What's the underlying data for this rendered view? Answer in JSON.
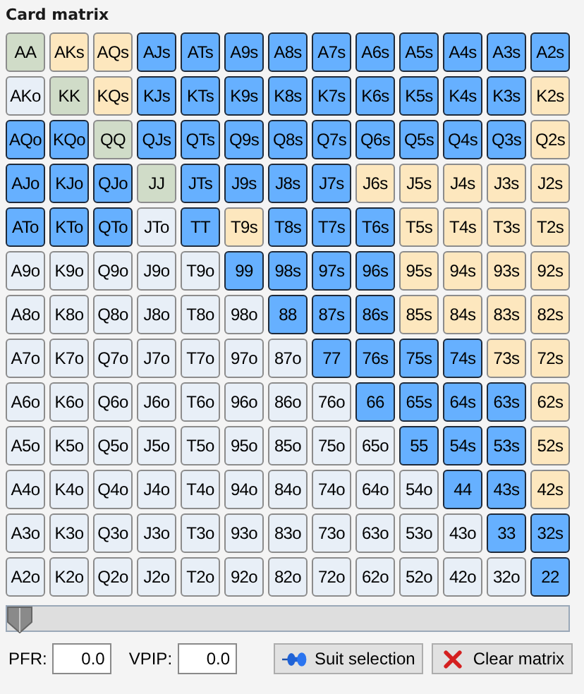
{
  "title": "Card matrix",
  "matrix": [
    [
      {
        "label": "AA",
        "selected": false
      },
      {
        "label": "AKs",
        "selected": false
      },
      {
        "label": "AQs",
        "selected": false
      },
      {
        "label": "AJs",
        "selected": true
      },
      {
        "label": "ATs",
        "selected": true
      },
      {
        "label": "A9s",
        "selected": true
      },
      {
        "label": "A8s",
        "selected": true
      },
      {
        "label": "A7s",
        "selected": true
      },
      {
        "label": "A6s",
        "selected": true
      },
      {
        "label": "A5s",
        "selected": true
      },
      {
        "label": "A4s",
        "selected": true
      },
      {
        "label": "A3s",
        "selected": true
      },
      {
        "label": "A2s",
        "selected": true
      }
    ],
    [
      {
        "label": "AKo",
        "selected": false
      },
      {
        "label": "KK",
        "selected": false
      },
      {
        "label": "KQs",
        "selected": false
      },
      {
        "label": "KJs",
        "selected": true
      },
      {
        "label": "KTs",
        "selected": true
      },
      {
        "label": "K9s",
        "selected": true
      },
      {
        "label": "K8s",
        "selected": true
      },
      {
        "label": "K7s",
        "selected": true
      },
      {
        "label": "K6s",
        "selected": true
      },
      {
        "label": "K5s",
        "selected": true
      },
      {
        "label": "K4s",
        "selected": true
      },
      {
        "label": "K3s",
        "selected": true
      },
      {
        "label": "K2s",
        "selected": false
      }
    ],
    [
      {
        "label": "AQo",
        "selected": true
      },
      {
        "label": "KQo",
        "selected": true
      },
      {
        "label": "QQ",
        "selected": false
      },
      {
        "label": "QJs",
        "selected": true
      },
      {
        "label": "QTs",
        "selected": true
      },
      {
        "label": "Q9s",
        "selected": true
      },
      {
        "label": "Q8s",
        "selected": true
      },
      {
        "label": "Q7s",
        "selected": true
      },
      {
        "label": "Q6s",
        "selected": true
      },
      {
        "label": "Q5s",
        "selected": true
      },
      {
        "label": "Q4s",
        "selected": true
      },
      {
        "label": "Q3s",
        "selected": true
      },
      {
        "label": "Q2s",
        "selected": false
      }
    ],
    [
      {
        "label": "AJo",
        "selected": true
      },
      {
        "label": "KJo",
        "selected": true
      },
      {
        "label": "QJo",
        "selected": true
      },
      {
        "label": "JJ",
        "selected": false
      },
      {
        "label": "JTs",
        "selected": true
      },
      {
        "label": "J9s",
        "selected": true
      },
      {
        "label": "J8s",
        "selected": true
      },
      {
        "label": "J7s",
        "selected": true
      },
      {
        "label": "J6s",
        "selected": false
      },
      {
        "label": "J5s",
        "selected": false
      },
      {
        "label": "J4s",
        "selected": false
      },
      {
        "label": "J3s",
        "selected": false
      },
      {
        "label": "J2s",
        "selected": false
      }
    ],
    [
      {
        "label": "ATo",
        "selected": true
      },
      {
        "label": "KTo",
        "selected": true
      },
      {
        "label": "QTo",
        "selected": true
      },
      {
        "label": "JTo",
        "selected": false
      },
      {
        "label": "TT",
        "selected": true
      },
      {
        "label": "T9s",
        "selected": false
      },
      {
        "label": "T8s",
        "selected": true
      },
      {
        "label": "T7s",
        "selected": true
      },
      {
        "label": "T6s",
        "selected": true
      },
      {
        "label": "T5s",
        "selected": false
      },
      {
        "label": "T4s",
        "selected": false
      },
      {
        "label": "T3s",
        "selected": false
      },
      {
        "label": "T2s",
        "selected": false
      }
    ],
    [
      {
        "label": "A9o",
        "selected": false
      },
      {
        "label": "K9o",
        "selected": false
      },
      {
        "label": "Q9o",
        "selected": false
      },
      {
        "label": "J9o",
        "selected": false
      },
      {
        "label": "T9o",
        "selected": false
      },
      {
        "label": "99",
        "selected": true
      },
      {
        "label": "98s",
        "selected": true
      },
      {
        "label": "97s",
        "selected": true
      },
      {
        "label": "96s",
        "selected": true
      },
      {
        "label": "95s",
        "selected": false
      },
      {
        "label": "94s",
        "selected": false
      },
      {
        "label": "93s",
        "selected": false
      },
      {
        "label": "92s",
        "selected": false
      }
    ],
    [
      {
        "label": "A8o",
        "selected": false
      },
      {
        "label": "K8o",
        "selected": false
      },
      {
        "label": "Q8o",
        "selected": false
      },
      {
        "label": "J8o",
        "selected": false
      },
      {
        "label": "T8o",
        "selected": false
      },
      {
        "label": "98o",
        "selected": false
      },
      {
        "label": "88",
        "selected": true
      },
      {
        "label": "87s",
        "selected": true
      },
      {
        "label": "86s",
        "selected": true
      },
      {
        "label": "85s",
        "selected": false
      },
      {
        "label": "84s",
        "selected": false
      },
      {
        "label": "83s",
        "selected": false
      },
      {
        "label": "82s",
        "selected": false
      }
    ],
    [
      {
        "label": "A7o",
        "selected": false
      },
      {
        "label": "K7o",
        "selected": false
      },
      {
        "label": "Q7o",
        "selected": false
      },
      {
        "label": "J7o",
        "selected": false
      },
      {
        "label": "T7o",
        "selected": false
      },
      {
        "label": "97o",
        "selected": false
      },
      {
        "label": "87o",
        "selected": false
      },
      {
        "label": "77",
        "selected": true
      },
      {
        "label": "76s",
        "selected": true
      },
      {
        "label": "75s",
        "selected": true
      },
      {
        "label": "74s",
        "selected": true
      },
      {
        "label": "73s",
        "selected": false
      },
      {
        "label": "72s",
        "selected": false
      }
    ],
    [
      {
        "label": "A6o",
        "selected": false
      },
      {
        "label": "K6o",
        "selected": false
      },
      {
        "label": "Q6o",
        "selected": false
      },
      {
        "label": "J6o",
        "selected": false
      },
      {
        "label": "T6o",
        "selected": false
      },
      {
        "label": "96o",
        "selected": false
      },
      {
        "label": "86o",
        "selected": false
      },
      {
        "label": "76o",
        "selected": false
      },
      {
        "label": "66",
        "selected": true
      },
      {
        "label": "65s",
        "selected": true
      },
      {
        "label": "64s",
        "selected": true
      },
      {
        "label": "63s",
        "selected": true
      },
      {
        "label": "62s",
        "selected": false
      }
    ],
    [
      {
        "label": "A5o",
        "selected": false
      },
      {
        "label": "K5o",
        "selected": false
      },
      {
        "label": "Q5o",
        "selected": false
      },
      {
        "label": "J5o",
        "selected": false
      },
      {
        "label": "T5o",
        "selected": false
      },
      {
        "label": "95o",
        "selected": false
      },
      {
        "label": "85o",
        "selected": false
      },
      {
        "label": "75o",
        "selected": false
      },
      {
        "label": "65o",
        "selected": false
      },
      {
        "label": "55",
        "selected": true
      },
      {
        "label": "54s",
        "selected": true
      },
      {
        "label": "53s",
        "selected": true
      },
      {
        "label": "52s",
        "selected": false
      }
    ],
    [
      {
        "label": "A4o",
        "selected": false
      },
      {
        "label": "K4o",
        "selected": false
      },
      {
        "label": "Q4o",
        "selected": false
      },
      {
        "label": "J4o",
        "selected": false
      },
      {
        "label": "T4o",
        "selected": false
      },
      {
        "label": "94o",
        "selected": false
      },
      {
        "label": "84o",
        "selected": false
      },
      {
        "label": "74o",
        "selected": false
      },
      {
        "label": "64o",
        "selected": false
      },
      {
        "label": "54o",
        "selected": false
      },
      {
        "label": "44",
        "selected": true
      },
      {
        "label": "43s",
        "selected": true
      },
      {
        "label": "42s",
        "selected": false
      }
    ],
    [
      {
        "label": "A3o",
        "selected": false
      },
      {
        "label": "K3o",
        "selected": false
      },
      {
        "label": "Q3o",
        "selected": false
      },
      {
        "label": "J3o",
        "selected": false
      },
      {
        "label": "T3o",
        "selected": false
      },
      {
        "label": "93o",
        "selected": false
      },
      {
        "label": "83o",
        "selected": false
      },
      {
        "label": "73o",
        "selected": false
      },
      {
        "label": "63o",
        "selected": false
      },
      {
        "label": "53o",
        "selected": false
      },
      {
        "label": "43o",
        "selected": false
      },
      {
        "label": "33",
        "selected": true
      },
      {
        "label": "32s",
        "selected": true
      }
    ],
    [
      {
        "label": "A2o",
        "selected": false
      },
      {
        "label": "K2o",
        "selected": false
      },
      {
        "label": "Q2o",
        "selected": false
      },
      {
        "label": "J2o",
        "selected": false
      },
      {
        "label": "T2o",
        "selected": false
      },
      {
        "label": "92o",
        "selected": false
      },
      {
        "label": "82o",
        "selected": false
      },
      {
        "label": "72o",
        "selected": false
      },
      {
        "label": "62o",
        "selected": false
      },
      {
        "label": "52o",
        "selected": false
      },
      {
        "label": "42o",
        "selected": false
      },
      {
        "label": "32o",
        "selected": false
      },
      {
        "label": "22",
        "selected": true
      }
    ]
  ],
  "slider": {
    "level": 0
  },
  "fields": [
    {
      "label": "PFR:",
      "value": "0.0"
    },
    {
      "label": "VPIP:",
      "value": "0.0"
    }
  ],
  "buttons": [
    {
      "label": "Suit selection",
      "kind": "suits"
    },
    {
      "label": "Clear matrix",
      "kind": "clear"
    }
  ]
}
